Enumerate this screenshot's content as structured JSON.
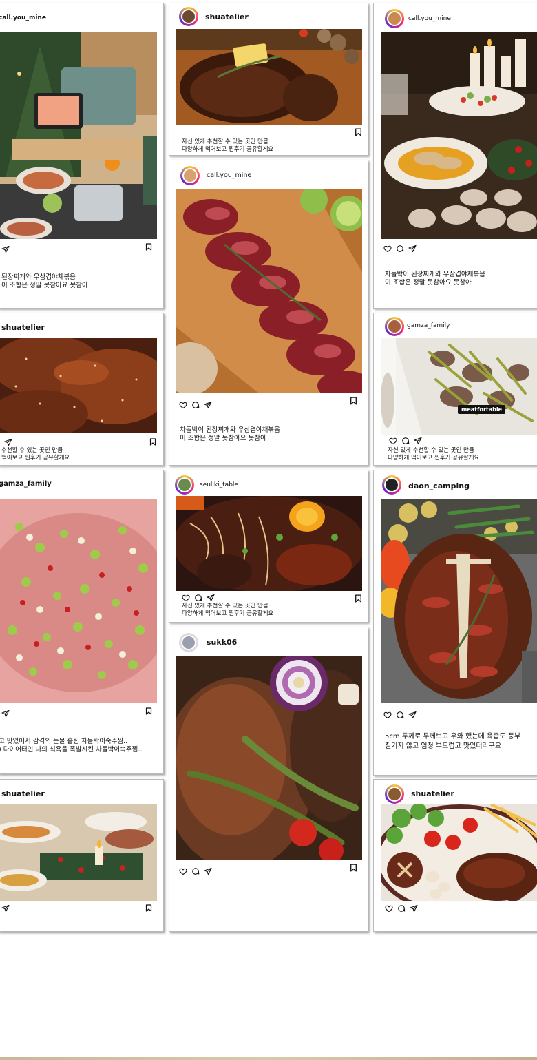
{
  "posts": {
    "c1_1": {
      "username": "call.you_mine",
      "caption": "된장찌개와 우삼겹야채볶음\n이 조합은 정말 못참아요 못참아",
      "photo_alt": "camping table with shrimp tablet and pot"
    },
    "c1_2": {
      "username": "shuatelier",
      "caption": "추천할 수 있는 곳인 만큼\n먹어보고 찐후기 공유할게요",
      "photo_alt": "grilled marinated ribs with sesame"
    },
    "c1_3": {
      "username": "gamza_family",
      "caption": "고 맛있어서 감격의 눈물 흘린 차돌박이숙주찜..\n) 다이어터인 나의 식욕을 폭발시킨 차돌박이숙주찜..",
      "photo_alt": "brisket with chopped leeks and peppers"
    },
    "c1_4": {
      "username": "shuatelier",
      "caption": "",
      "photo_alt": "holiday table with food"
    },
    "c2_1": {
      "username": "shuatelier",
      "caption": "자신 있게 추천할 수 있는 곳인 만큼\n다양하게 먹어보고 찐후기 공유할게요",
      "photo_alt": "steak with butter and rosemary"
    },
    "c2_2": {
      "username": "call.you_mine",
      "caption": "차돌박이 된장찌개와 우삼겹야채볶음\n이 조합은 정말 못참아요 못참아",
      "photo_alt": "sliced raw beef on wooden board with rosemary"
    },
    "c2_3": {
      "username": "seullki_table",
      "caption": "자신 있게 추천할 수 있는 곳인 만큼\n다양하게 먹어보고 찐후기 공유할게요",
      "photo_alt": "noodles with galbi and egg yolk"
    },
    "c2_4": {
      "username": "sukk06",
      "caption": "",
      "photo_alt": "t-bone steak with asparagus onion and tomatoes"
    },
    "c3_1": {
      "username": "call.you_mine",
      "caption": "차돌박이 된장찌개와 우삼겹야채볶음\n이 조합은 정말 못참아요 못참아",
      "photo_alt": "christmas dinner table with candles"
    },
    "c3_2": {
      "username": "gamza_family",
      "caption": "자신 있게 추천할 수 있는 곳인 만큼\n다양하게 먹어보고 찐후기 공유할게요",
      "badge": "meatfortable",
      "photo_alt": "beef with garlic stems on white plate"
    },
    "c3_3": {
      "username": "daon_camping",
      "caption": "5cm 두께로 두께보고 우와 했는데 육즙도 풍부\n질기지 않고 엄청 부드럽고 맛있더라구요",
      "photo_alt": "sliced t-bone steak with vegetables"
    },
    "c3_4": {
      "username": "shuatelier",
      "caption": "",
      "photo_alt": "steak with fries and mushrooms"
    }
  },
  "icons": {
    "like": "heart-icon",
    "comment": "comment-icon",
    "share": "share-icon",
    "save": "bookmark-icon"
  },
  "colors": {
    "card_border": "#b9b9b9",
    "avatar_ring_start": "#f9ce34",
    "avatar_ring_mid": "#ee2a7b",
    "avatar_ring_end": "#6228d7",
    "emoji": "#f2a02a"
  }
}
